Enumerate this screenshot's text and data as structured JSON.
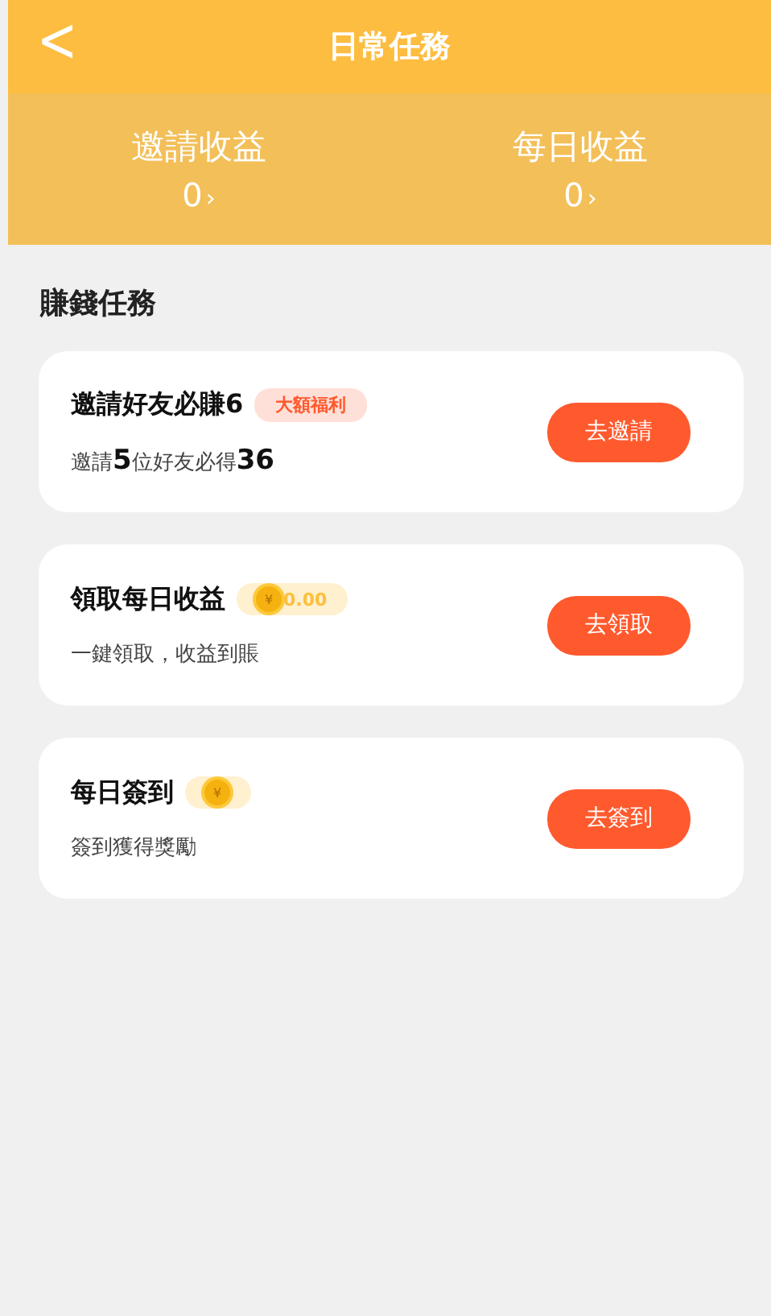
{
  "header": {
    "back_icon": "<",
    "title": "日常任務"
  },
  "stats": [
    {
      "label": "邀請收益",
      "value": "0",
      "arrow": "›"
    },
    {
      "label": "每日收益",
      "value": "0",
      "arrow": "›"
    }
  ],
  "section_title": "賺錢任務",
  "tasks": [
    {
      "title": "邀請好友必賺6",
      "badge": {
        "kind": "tag",
        "text": "大額福利"
      },
      "subtitle": "邀請**5**位好友必得**36**",
      "button": "去邀請"
    },
    {
      "title": "領取每日收益",
      "badge": {
        "kind": "coin",
        "symbol": "¥",
        "amount": "0.00"
      },
      "subtitle": "一鍵領取，收益到賬",
      "button": "去領取"
    },
    {
      "title": "每日簽到",
      "badge": {
        "kind": "coin",
        "symbol": "¥"
      },
      "subtitle": "簽到獲得獎勵",
      "button": "去簽到"
    }
  ]
}
